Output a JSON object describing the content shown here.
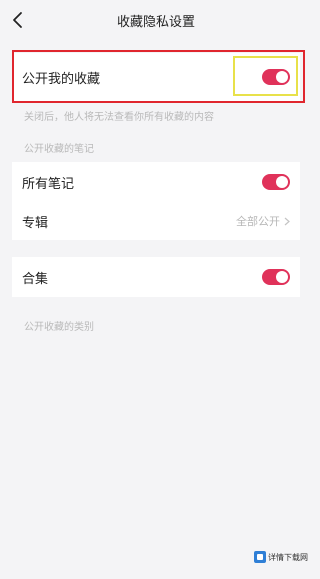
{
  "header": {
    "back_icon": "chevron-left-icon",
    "title": "收藏隐私设置"
  },
  "public_collection": {
    "label": "公开我的收藏",
    "enabled": true,
    "hint": "关闭后，他人将无法查看你所有收藏的内容"
  },
  "notes_section": {
    "header": "公开收藏的笔记",
    "all_notes": {
      "label": "所有笔记",
      "enabled": true
    },
    "album": {
      "label": "专辑",
      "value": "全部公开",
      "chevron_icon": "chevron-right-icon"
    }
  },
  "collection_set": {
    "label": "合集",
    "enabled": true
  },
  "categories_header": "公开收藏的类别",
  "watermark": {
    "text": "详情下载网"
  },
  "colors": {
    "toggle_on": "#e0325a",
    "highlight_red": "#e0262e",
    "highlight_yellow": "#e8e14a"
  }
}
